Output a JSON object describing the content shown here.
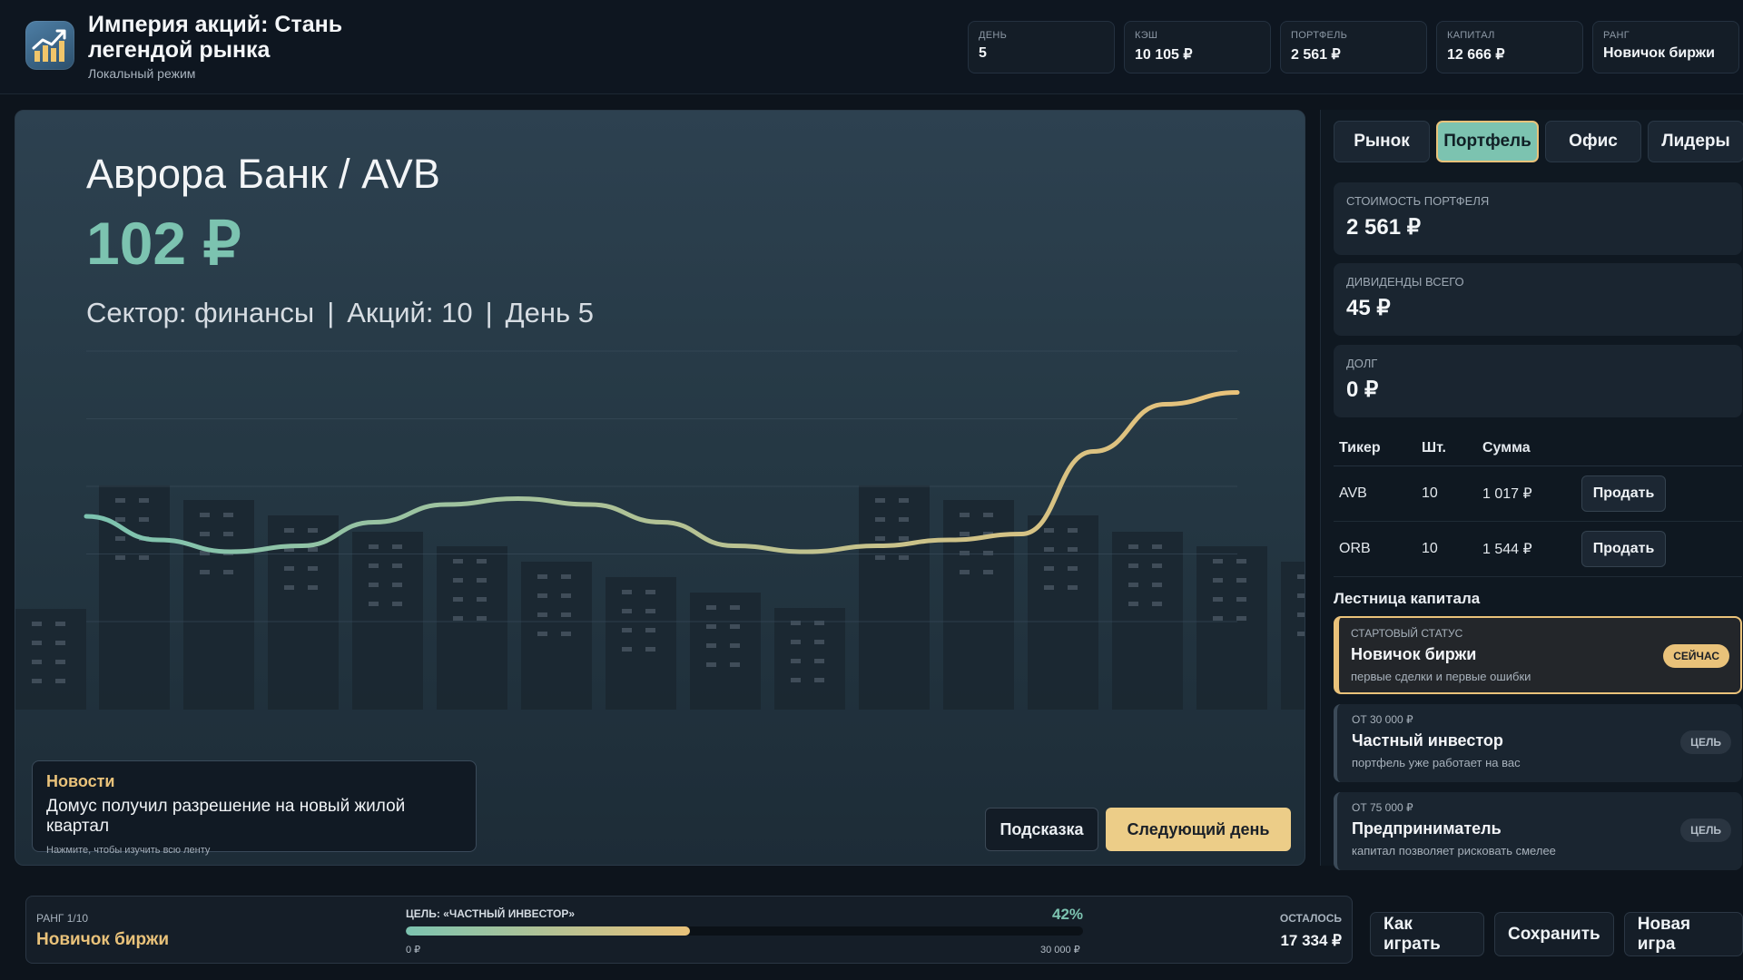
{
  "app": {
    "title": "Империя акций: Стань легендой рынка",
    "mode": "Локальный режим",
    "logo_icon": "chart-growth-icon"
  },
  "stats": [
    {
      "label": "ДЕНЬ",
      "value": "5"
    },
    {
      "label": "КЭШ",
      "value": "10 105 ₽"
    },
    {
      "label": "ПОРТФЕЛЬ",
      "value": "2 561 ₽"
    },
    {
      "label": "КАПИТАЛ",
      "value": "12 666 ₽"
    },
    {
      "label": "РАНГ",
      "value": "Новичок биржи"
    }
  ],
  "stock": {
    "title": "Аврора Банк / AVB",
    "price": "102 ₽",
    "sector": "Сектор: финансы",
    "shares": "Акций: 10",
    "day": "День 5",
    "separator": "|"
  },
  "chart_data": {
    "type": "line",
    "series": [
      {
        "values": [
          102,
          98,
          96,
          97,
          101,
          104,
          105,
          104,
          101,
          97,
          96,
          97,
          98,
          99,
          113,
          121,
          123
        ]
      }
    ],
    "xlabel": "",
    "ylabel": "",
    "grid": true,
    "colors": {
      "start": "#7cc3b0",
      "end": "#e9c27a"
    }
  },
  "news": {
    "title": "Новости",
    "text": "Домус получил разрешение на новый жилой квартал",
    "hint": "Нажмите, чтобы изучить всю ленту"
  },
  "actions": {
    "hint": "Подсказка",
    "next_day": "Следующий день"
  },
  "tabs": [
    {
      "label": "Рынок",
      "active": false
    },
    {
      "label": "Портфель",
      "active": true
    },
    {
      "label": "Офис",
      "active": false
    },
    {
      "label": "Лидеры",
      "active": false
    }
  ],
  "portfolio": {
    "value_label": "СТОИМОСТЬ ПОРТФЕЛЯ",
    "value": "2 561 ₽",
    "dividends_label": "ДИВИДЕНДЫ ВСЕГО",
    "dividends": "45 ₽",
    "debt_label": "ДОЛГ",
    "debt": "0 ₽"
  },
  "holdings": {
    "headers": [
      "Тикер",
      "Шт.",
      "Сумма"
    ],
    "sell_label": "Продать",
    "rows": [
      {
        "ticker": "AVB",
        "qty": "10",
        "sum": "1 017 ₽"
      },
      {
        "ticker": "ORB",
        "qty": "10",
        "sum": "1 544 ₽"
      }
    ]
  },
  "ladder": {
    "title": "Лестница капитала",
    "items": [
      {
        "sub": "СТАРТОВЫЙ СТАТУС",
        "name": "Новичок биржи",
        "desc": "первые сделки и первые ошибки",
        "badge": "СЕЙЧАС",
        "current": true
      },
      {
        "sub": "ОТ 30 000 ₽",
        "name": "Частный инвестор",
        "desc": "портфель уже работает на вас",
        "badge": "ЦЕЛЬ",
        "current": false
      },
      {
        "sub": "ОТ 75 000 ₽",
        "name": "Предприниматель",
        "desc": "капитал позволяет рисковать смелее",
        "badge": "ЦЕЛЬ",
        "current": false
      }
    ]
  },
  "footer": {
    "rank_label": "РАНГ 1/10",
    "rank_value": "Новичок биржи",
    "goal_label": "ЦЕЛЬ: «ЧАСТНЫЙ ИНВЕСТОР»",
    "goal_pct": "42%",
    "progress": 0.42,
    "goal_min": "0 ₽",
    "goal_max": "30 000 ₽",
    "left_label": "ОСТАЛОСЬ",
    "left_value": "17 334 ₽",
    "buttons": [
      "Как играть",
      "Сохранить",
      "Новая игра"
    ]
  }
}
